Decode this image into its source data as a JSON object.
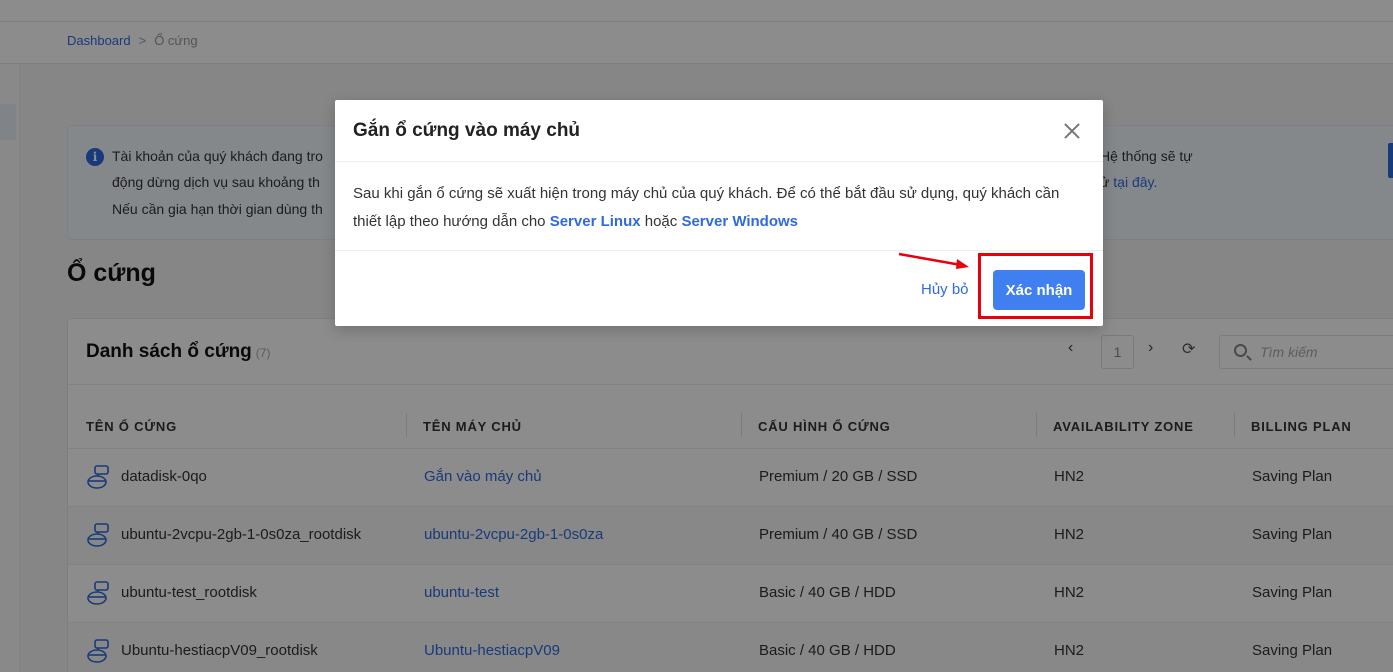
{
  "breadcrumb": {
    "home": "Dashboard",
    "separator": ">",
    "current": "Ổ cứng"
  },
  "notice": {
    "line1_left": "Tài khoản của quý khách đang tro",
    "line2_left": "động dừng dịch vụ sau khoảng th",
    "line3_left": "Nếu cần gia hạn thời gian dùng th",
    "line1_right": "Hệ thống sẽ tự",
    "line2_right_prefix": "ử",
    "line2_right_link": "tại đây."
  },
  "page": {
    "title": "Ổ cứng"
  },
  "panel": {
    "title": "Danh sách ổ cứng",
    "count": "(7)",
    "pager": {
      "prev": "‹",
      "page": "1",
      "next": "›",
      "refresh": "⟳"
    },
    "search_placeholder": "Tìm kiếm"
  },
  "table": {
    "headers": [
      "TÊN Ổ CỨNG",
      "TÊN MÁY CHỦ",
      "CẤU HÌNH Ổ CỨNG",
      "AVAILABILITY ZONE",
      "BILLING PLAN"
    ],
    "rows": [
      {
        "name": "datadisk-0qo",
        "server": "Gắn vào máy chủ",
        "config": "Premium / 20 GB / SSD",
        "zone": "HN2",
        "plan": "Saving Plan"
      },
      {
        "name": "ubuntu-2vcpu-2gb-1-0s0za_rootdisk",
        "server": "ubuntu-2vcpu-2gb-1-0s0za",
        "config": "Premium / 40 GB / SSD",
        "zone": "HN2",
        "plan": "Saving Plan"
      },
      {
        "name": "ubuntu-test_rootdisk",
        "server": "ubuntu-test",
        "config": "Basic / 40 GB / HDD",
        "zone": "HN2",
        "plan": "Saving Plan"
      },
      {
        "name": "Ubuntu-hestiacpV09_rootdisk",
        "server": "Ubuntu-hestiacpV09",
        "config": "Basic / 40 GB / HDD",
        "zone": "HN2",
        "plan": "Saving Plan"
      }
    ]
  },
  "modal": {
    "title": "Gắn ổ cứng vào máy chủ",
    "body_line1": "Sau khi gắn ổ cứng sẽ xuất hiện trong máy chủ của quý khách. Để có thể bắt đầu sử dụng, quý khách cần",
    "body_line2_prefix": "thiết lập theo hướng dẫn cho",
    "link_linux": "Server Linux",
    "body_line2_mid": "hoặc",
    "link_windows": "Server Windows",
    "cancel_label": "Hủy bỏ",
    "confirm_label": "Xác nhận"
  },
  "colors": {
    "accent": "#2f6bde",
    "confirm": "#3f7ff0",
    "highlight": "#e8000b"
  },
  "icons": {
    "info": "info-icon",
    "disk": "disk-icon",
    "close": "close-icon",
    "search": "search-icon"
  }
}
